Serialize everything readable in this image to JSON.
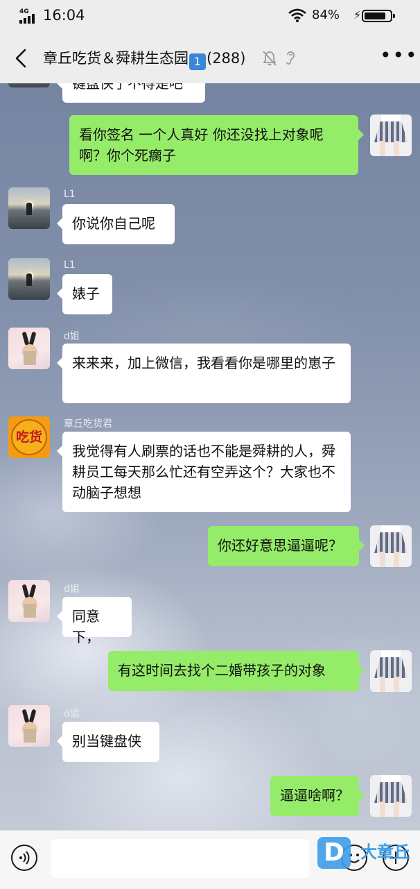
{
  "status_bar": {
    "network": "4G",
    "time": "16:04",
    "battery": "84%",
    "battery_level": 0.84
  },
  "nav": {
    "title_name": "章丘吃货＆舜耕生态园",
    "title_badge": "1",
    "title_count": "(288)",
    "more_label": "•••"
  },
  "messages": [
    {
      "side": "left",
      "sender": "",
      "text": "键盘侠了不得是吧",
      "avatar": "sunset-icon"
    },
    {
      "side": "right",
      "text": "看你签名 一个人真好 你还没找上对象呢啊？你个死瘸子",
      "avatar": "skirt-icon"
    },
    {
      "side": "left",
      "sender": "L1",
      "text": "你说你自己呢",
      "avatar": "sunset-icon"
    },
    {
      "side": "left",
      "sender": "L1",
      "text": "婊子",
      "avatar": "sunset-icon"
    },
    {
      "side": "left",
      "sender": "d姐",
      "text": "来来来，加上微信，我看看你是哪里的崽子",
      "avatar": "bunny-icon"
    },
    {
      "side": "left",
      "sender": "章丘吃货君",
      "text": "我觉得有人刷票的话也不能是舜耕的人，舜耕员工每天那么忙还有空弄这个？大家也不动脑子想想",
      "avatar": "logo-icon"
    },
    {
      "side": "right",
      "text": "你还好意思逼逼呢？",
      "avatar": "skirt-icon"
    },
    {
      "side": "left",
      "sender": "d姐",
      "text": "同意下，",
      "avatar": "bunny-icon"
    },
    {
      "side": "right",
      "text": "有这时间去找个二婚带孩子的对象",
      "avatar": "skirt-icon"
    },
    {
      "side": "left",
      "sender": "d姐",
      "text": "别当键盘侠",
      "avatar": "bunny-icon"
    },
    {
      "side": "right",
      "text": "逼逼啥啊？",
      "avatar": "skirt-icon"
    }
  ],
  "avatar_logo_text": "吃货",
  "composer": {
    "input_value": ""
  },
  "watermark": {
    "logo_letter": "D",
    "text": "大章丘"
  },
  "colors": {
    "bubble_green": "#95ec69",
    "bubble_white": "#ffffff",
    "bar_bg": "#ededed",
    "watermark_blue": "#3f9ee8"
  }
}
